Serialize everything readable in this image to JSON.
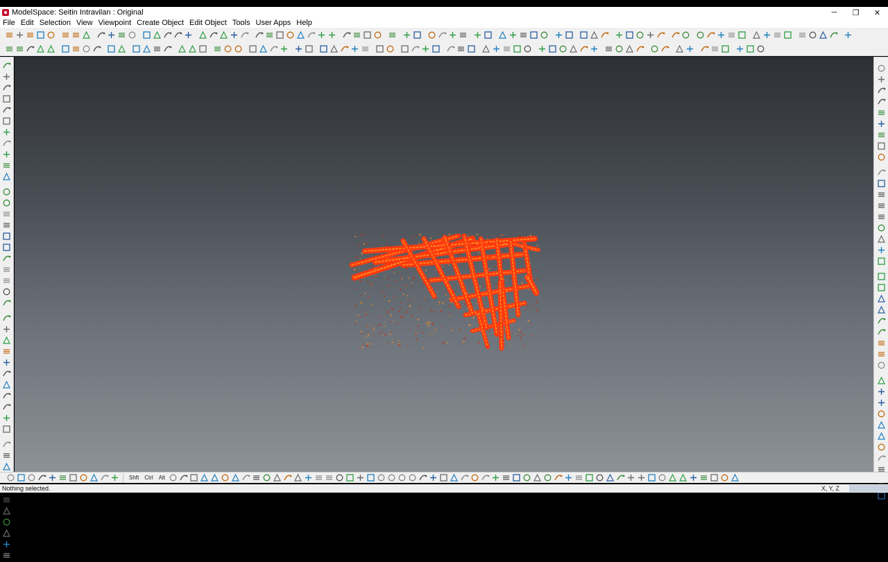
{
  "window": {
    "title": "ModelSpace: Seitin Intravilan : Original",
    "minimize": "─",
    "restore": "❐",
    "close": "✕"
  },
  "menu": [
    "File",
    "Edit",
    "Selection",
    "View",
    "Viewpoint",
    "Create Object",
    "Edit Object",
    "Tools",
    "User Apps",
    "Help"
  ],
  "toolbar_row1_groups": [
    [
      "layers-icon",
      "open-icon",
      "save-icon",
      "edit-icon",
      "properties-icon"
    ],
    [
      "print-icon",
      "copy-icon",
      "folder-icon"
    ],
    [
      "filter-x-icon",
      "filter-y-icon",
      "filter-z-icon",
      "pin-icon"
    ],
    [
      "grid-icon",
      "grid2-icon",
      "grid3-icon",
      "snap-icon",
      "help-icon"
    ],
    [
      "cross-icon",
      "globe-icon",
      "arc-icon",
      "lock-icon",
      "scissors-icon"
    ],
    [
      "curve-icon",
      "curve2-icon",
      "curve3-icon",
      "curve4-icon",
      "curve5-icon",
      "curve6-icon",
      "branch-icon",
      "split-icon"
    ],
    [
      "axis-icon",
      "axis2-icon",
      "axis3-icon",
      "axis4-icon"
    ],
    [
      "ruler-icon"
    ],
    [
      "transform-icon",
      "transform2-icon"
    ],
    [
      "table-icon",
      "table2-icon",
      "table3-icon",
      "table4-icon"
    ],
    [
      "zoom-in-icon",
      "zoom-out-icon"
    ],
    [
      "zoom-icon",
      "zoom2-icon",
      "zoom3-icon",
      "zoom4-icon",
      "zoom5-icon"
    ],
    [
      "globe-green-icon",
      "globe2-icon"
    ],
    [
      "sphere-icon",
      "sphere2-icon",
      "sphere3-icon"
    ],
    [
      "box-icon",
      "box2-icon",
      "box3-icon",
      "pencil-green-icon",
      "wall-icon"
    ],
    [
      "layers2-icon",
      "cube-icon"
    ],
    [
      "view-icon",
      "view2-icon",
      "view3-icon",
      "view4-icon",
      "view5-icon"
    ],
    [
      "path-icon",
      "path2-icon",
      "path3-icon",
      "path4-icon"
    ],
    [
      "render-icon",
      "render2-icon",
      "render3-icon",
      "render4-icon"
    ],
    [
      "hand-icon"
    ]
  ],
  "toolbar_row2_groups": [
    [
      "select-arrow-icon",
      "select-plus-icon",
      "pan-hand-icon",
      "rotate-icon",
      "lasso-icon"
    ],
    [
      "pencil-icon",
      "move-icon",
      "scale-icon",
      "target-icon"
    ],
    [
      "shape-icon",
      "shape2-icon"
    ],
    [
      "crop-icon",
      "rect-select-icon",
      "circle-select-icon",
      "cone-icon"
    ],
    [
      "paint-icon",
      "fill-icon",
      "palette-icon"
    ],
    [
      "network-icon",
      "network2-icon",
      "layers3-icon"
    ],
    [
      "surface-icon",
      "surface2-icon",
      "surface3-icon",
      "surface4-icon"
    ],
    [
      "mesh-icon",
      "mesh2-icon"
    ],
    [
      "green-block-icon",
      "green-block2-icon",
      "green-block3-icon",
      "green-block4-icon",
      "green-block5-icon"
    ],
    [
      "undo-icon",
      "redo-icon"
    ],
    [
      "cut-icon",
      "copy2-icon",
      "paste-icon",
      "delete-icon"
    ],
    [
      "frame-icon",
      "frame2-icon",
      "frame3-icon"
    ],
    [
      "edit-line-icon",
      "edit-line2-icon",
      "edit-line3-icon",
      "edit-line4-icon",
      "edit-line5-icon"
    ],
    [
      "join-icon",
      "join2-icon",
      "join3-icon",
      "join4-icon",
      "join5-icon",
      "join6-icon"
    ],
    [
      "trim-icon",
      "trim2-icon",
      "trim3-icon",
      "trim4-icon"
    ],
    [
      "model-icon",
      "model2-icon"
    ],
    [
      "layer-icon",
      "layer2-icon"
    ],
    [
      "stack-icon",
      "stack2-icon",
      "stack3-icon"
    ],
    [
      "arrow-icon",
      "arrow2-icon",
      "arrow3-icon"
    ]
  ],
  "left_tools": [
    "draw-icon",
    "line-icon",
    "polyline-icon",
    "curve-tool-icon",
    "spline-icon",
    "arc-tool-icon",
    "circle-tool-icon",
    "rect-tool-icon",
    "text-tool-icon",
    "dim-icon",
    "label-icon",
    "cone-tool-icon",
    "cylinder-icon",
    "sphere-tool-icon",
    "hook-icon",
    "loop-icon",
    "cap-icon",
    "rotate-tool-icon",
    "mirror-icon",
    "array-icon",
    "offset-icon",
    "chamfer-icon",
    "fillet-icon",
    "extend-icon",
    "trim-tool-icon",
    "break-icon",
    "join-tool-icon",
    "explode-icon",
    "pencil-tool-icon",
    "knife-icon",
    "wand-icon",
    "ruler-tool-icon",
    "angle-icon",
    "polygon-icon",
    "box-tool-icon",
    "bend-icon",
    "shape-tool-icon",
    "path-tool-icon",
    "node-icon",
    "vertex-icon",
    "edge-icon",
    "face-icon",
    "solid-icon",
    "check-icon"
  ],
  "right_tools": [
    "settings-icon",
    "info-icon",
    "bookmark-icon",
    "layer-r-icon",
    "filter-r-icon",
    "edit-r-icon",
    "path-r-icon",
    "bend-r-icon",
    "draw-r-icon",
    "slope-r-icon",
    "measure-r-icon",
    "stack-r-icon",
    "clip-r-icon",
    "cut-r-icon",
    "mark-r-icon",
    "line-r-icon",
    "curve-r-icon",
    "curve2-r-icon",
    "align-r-icon",
    "swap-r-icon",
    "point-r-icon",
    "help-r-icon",
    "link-r-icon",
    "pin-r-icon",
    "dots-r-icon",
    "doc-r-icon",
    "book-r-icon",
    "grid-r-icon",
    "clone-r-icon",
    "save-r-icon",
    "export-r-icon",
    "import-r-icon",
    "print-r-icon",
    "tag-r-icon",
    "note-r-icon",
    "share-r-icon",
    "star-r-icon",
    "flag-r-icon"
  ],
  "bottom_tools": {
    "left_icons": [
      "filter-b-icon",
      "axis-b-icon",
      "line-b-icon",
      "line2-b-icon",
      "line3-b-icon",
      "line4-b-icon",
      "line5-b-icon",
      "line6-b-icon",
      "line7-b-icon",
      "line8-b-icon",
      "line9-b-icon"
    ],
    "shift_label": "Shft",
    "ctrl_label": "Ctrl",
    "alt_label": "Alt",
    "right_icons": [
      "mouse-icon",
      "lock-b-icon",
      "cursor-b-icon",
      "bracket-b-icon",
      "anchor-b-icon",
      "down-b-icon",
      "help-b-icon",
      "cube-b-icon",
      "lasso-b-icon",
      "lasso2-b-icon",
      "lasso3-b-icon",
      "lasso4-b-icon",
      "grid-b-icon",
      "cross-b-icon",
      "frame-b-icon",
      "tilt-b-icon",
      "orbit-b-icon",
      "dot-b-icon",
      "circle-b-icon",
      "circle2-b-icon",
      "circle3-b-icon",
      "record-b-icon",
      "cube2-b-icon",
      "zoom-b-icon",
      "zoom2-b-icon",
      "zoom3-b-icon",
      "rotate-b-icon",
      "rotate2-b-icon",
      "rotate3-b-icon",
      "walk-b-icon",
      "walk2-b-icon",
      "walk3-b-icon",
      "walk4-b-icon",
      "walk5-b-icon",
      "walk6-b-icon",
      "walk7-b-icon",
      "fly-b-icon",
      "fly2-b-icon",
      "fly3-b-icon",
      "fly4-b-icon",
      "fly5-b-icon",
      "fly6-b-icon",
      "fly7-b-icon",
      "fly8-b-icon",
      "fly9-b-icon",
      "eye-b-icon",
      "eye2-b-icon",
      "eye3-b-icon",
      "eye4-b-icon",
      "cyl-b-icon",
      "cyl2-b-icon",
      "cyl3-b-icon",
      "play-b-icon",
      "prev-b-icon",
      "next-b-icon"
    ]
  },
  "status": {
    "message": "Nothing selected.",
    "coords": "X, Y, Z"
  },
  "viewport": {
    "model_color": "#ff3a10",
    "model_highlight": "#ff8a20"
  }
}
